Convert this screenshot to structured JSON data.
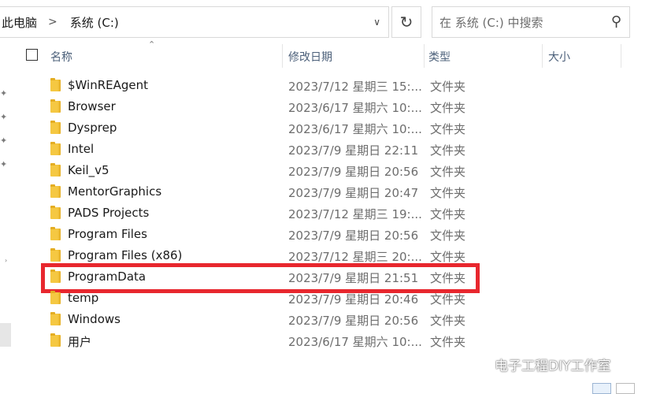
{
  "address": {
    "crumb1": "此电脑",
    "separator": ">",
    "crumb2": "系统 (C:)"
  },
  "search": {
    "placeholder": "在 系统 (C:) 中搜索"
  },
  "columns": {
    "name": "名称",
    "date": "修改日期",
    "type": "类型",
    "size": "大小"
  },
  "rows": [
    {
      "name": "$WinREAgent",
      "date": "2023/7/12 星期三 15:...",
      "type": "文件夹"
    },
    {
      "name": "Browser",
      "date": "2023/6/17 星期六 10:...",
      "type": "文件夹"
    },
    {
      "name": "Dysprep",
      "date": "2023/6/17 星期六 10:...",
      "type": "文件夹"
    },
    {
      "name": "Intel",
      "date": "2023/7/9 星期日 22:11",
      "type": "文件夹"
    },
    {
      "name": "Keil_v5",
      "date": "2023/7/9 星期日 20:56",
      "type": "文件夹"
    },
    {
      "name": "MentorGraphics",
      "date": "2023/7/9 星期日 20:47",
      "type": "文件夹"
    },
    {
      "name": "PADS Projects",
      "date": "2023/7/12 星期三 19:...",
      "type": "文件夹"
    },
    {
      "name": "Program Files",
      "date": "2023/7/9 星期日 20:56",
      "type": "文件夹"
    },
    {
      "name": "Program Files (x86)",
      "date": "2023/7/12 星期三 20:...",
      "type": "文件夹"
    },
    {
      "name": "ProgramData",
      "date": "2023/7/9 星期日 21:51",
      "type": "文件夹"
    },
    {
      "name": "temp",
      "date": "2023/7/9 星期日 20:46",
      "type": "文件夹"
    },
    {
      "name": "Windows",
      "date": "2023/7/9 星期日 20:56",
      "type": "文件夹"
    },
    {
      "name": "用户",
      "date": "2023/6/17 星期六 10:...",
      "type": "文件夹"
    }
  ],
  "watermark": "电子工程DIY工作室",
  "colors": {
    "highlight": "#e8272e",
    "folder": "#f5c842",
    "header_text": "#4c607a"
  }
}
